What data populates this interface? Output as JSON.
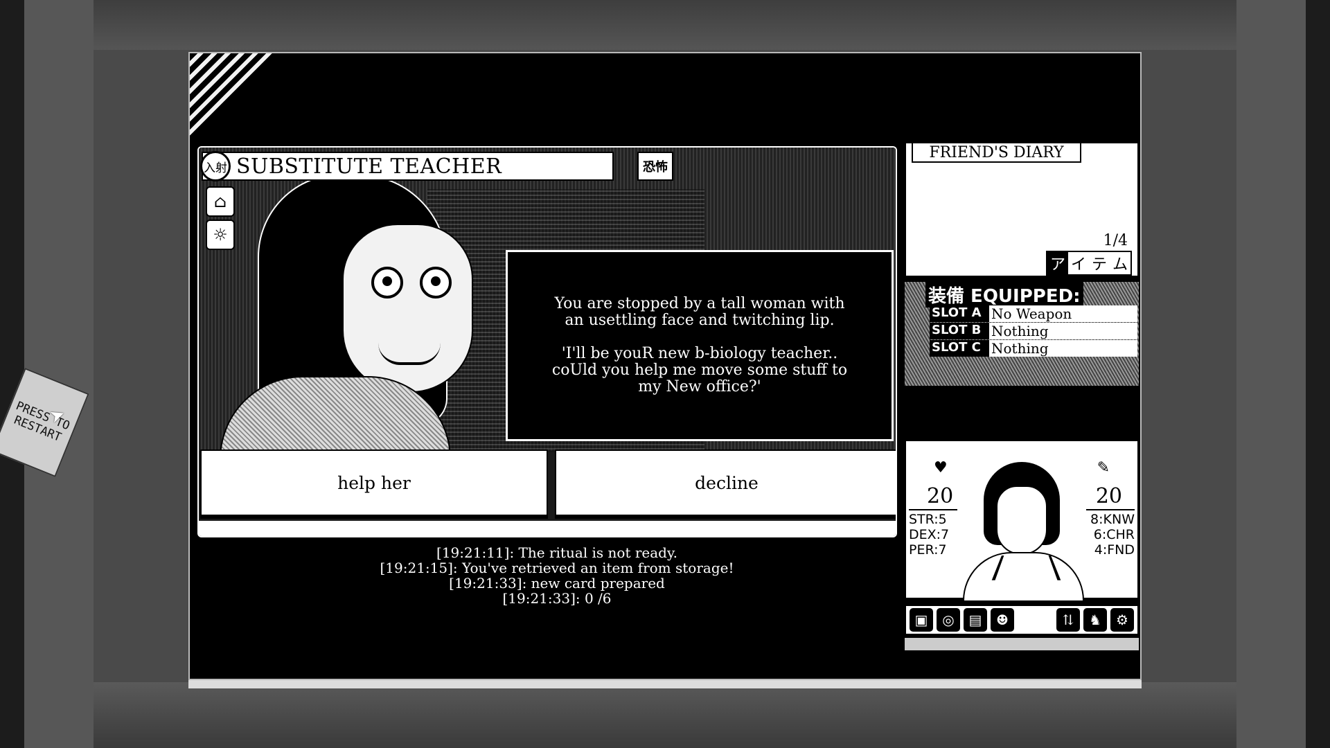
{
  "event": {
    "badge": "入射",
    "title": "SUBSTITUTE TEACHER",
    "tag": "恐怖",
    "side_icons": [
      "school-icon",
      "sun-icon"
    ],
    "dialog": [
      "You are stopped by a tall woman with\nan usettling face and twitching lip.",
      "'I'll be youR new b-biology teacher..\ncoUld you help me move some stuff to\nmy New office?'"
    ],
    "choices": [
      "help her",
      "decline"
    ]
  },
  "log": [
    "[19:21:11]: The ritual is not ready.",
    "[19:21:15]: You've retrieved an item from storage!",
    "[19:21:33]: new card prepared",
    "[19:21:33]: 0 /6"
  ],
  "diary": {
    "title": "FRIEND'S DIARY",
    "page": "1/4",
    "items_label": [
      "ア",
      "イ",
      "テ",
      "ム"
    ]
  },
  "equipped": {
    "header": "装備 EQUIPPED:",
    "slots": [
      {
        "key": "SLOT A",
        "value": "No Weapon"
      },
      {
        "key": "SLOT B",
        "value": "Nothing"
      },
      {
        "key": "SLOT C",
        "value": "Nothing"
      }
    ]
  },
  "character": {
    "stamina": "20",
    "reason": "20",
    "str": "STR:5",
    "dex": "DEX:7",
    "per": "PER:7",
    "knw": "8:KNW",
    "chr": "6:CHR",
    "fnd": "4:FND",
    "stamina_icon": "heart-icon",
    "reason_icon": "brain-icon"
  },
  "toolbar": {
    "left_icons": [
      "bag-icon",
      "spiral-icon",
      "photo-icon",
      "people-icon"
    ],
    "right_icons": [
      "stats-icon",
      "elephant-icon",
      "gear-icon"
    ]
  },
  "note": {
    "text": "PRESS TO RESTART"
  }
}
